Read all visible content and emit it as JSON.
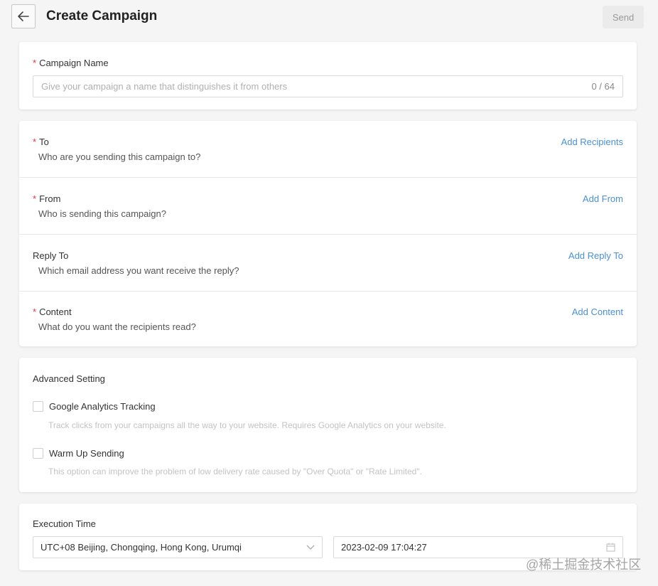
{
  "header": {
    "title": "Create Campaign",
    "send_label": "Send"
  },
  "campaign_name": {
    "label": "Campaign Name",
    "required_mark": "*",
    "placeholder": "Give your campaign a name that distinguishes it from others",
    "counter": "0 / 64"
  },
  "sections": [
    {
      "label": "To",
      "required": "*",
      "description": "Who are you sending this campaign to?",
      "action": "Add Recipients"
    },
    {
      "label": "From",
      "required": "*",
      "description": "Who is sending this campaign?",
      "action": "Add From"
    },
    {
      "label": "Reply To",
      "required": "",
      "description": "Which email address you want receive the reply?",
      "action": "Add Reply To"
    },
    {
      "label": "Content",
      "required": "*",
      "description": "What do you want the recipients read?",
      "action": "Add Content"
    }
  ],
  "advanced": {
    "title": "Advanced Setting",
    "options": [
      {
        "label": "Google Analytics Tracking",
        "hint": "Track clicks from your campaigns all the way to your website. Requires Google Analytics on your website.",
        "checked": false
      },
      {
        "label": "Warm Up Sending",
        "hint": "This option can improve the problem of low delivery rate caused by \"Over Quota\" or \"Rate Limited\".",
        "checked": false
      }
    ]
  },
  "execution": {
    "title": "Execution Time",
    "timezone": "UTC+08 Beijing, Chongqing, Hong Kong, Urumqi",
    "datetime": "2023-02-09 17:04:27"
  },
  "watermark": "@稀土掘金技术社区",
  "icons": {
    "back": "arrow-left-icon",
    "dropdown": "chevron-down-icon",
    "calendar": "calendar-icon"
  },
  "colors": {
    "required": "#e33333",
    "link": "#4a90d9",
    "background": "#f5f5f5"
  }
}
